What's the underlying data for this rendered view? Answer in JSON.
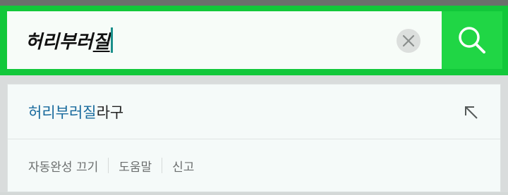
{
  "search": {
    "query_prefix": "허리부러",
    "query_last": "질",
    "clear_icon": "close-icon",
    "search_icon": "search-icon"
  },
  "suggestions": [
    {
      "match": "허리부러질",
      "rest": "라구",
      "arrow_icon": "arrow-up-left-icon"
    }
  ],
  "footer": {
    "autocomplete_off": "자동완성 끄기",
    "help": "도움말",
    "report": "신고"
  },
  "colors": {
    "brand_green": "#12c83a",
    "search_button": "#20d645",
    "match_text": "#17699c"
  }
}
